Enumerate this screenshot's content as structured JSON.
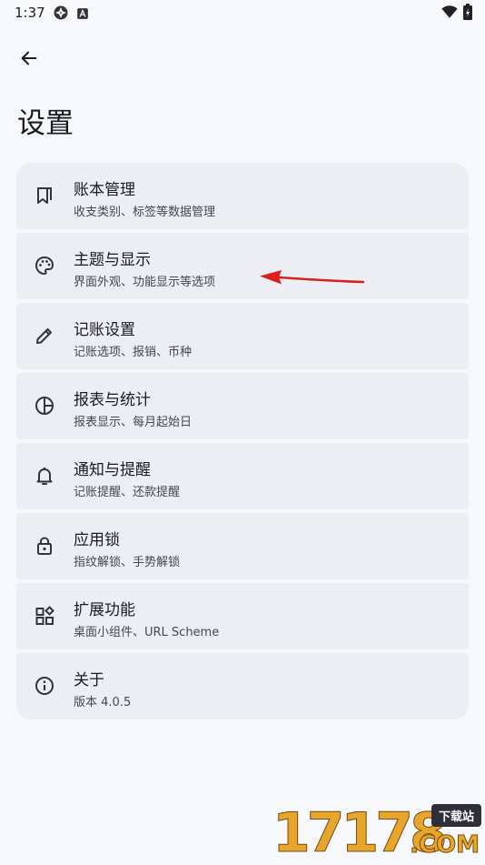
{
  "status_bar": {
    "time": "1:37"
  },
  "page": {
    "title": "设置"
  },
  "settings": [
    {
      "icon": "book-icon",
      "title": "账本管理",
      "subtitle": "收支类别、标签等数据管理"
    },
    {
      "icon": "palette-icon",
      "title": "主题与显示",
      "subtitle": "界面外观、功能显示等选项"
    },
    {
      "icon": "pencil-icon",
      "title": "记账设置",
      "subtitle": "记账选项、报销、币种"
    },
    {
      "icon": "pie-chart-icon",
      "title": "报表与统计",
      "subtitle": "报表显示、每月起始日"
    },
    {
      "icon": "bell-icon",
      "title": "通知与提醒",
      "subtitle": "记账提醒、还款提醒"
    },
    {
      "icon": "lock-icon",
      "title": "应用锁",
      "subtitle": "指纹解锁、手势解锁"
    },
    {
      "icon": "widgets-icon",
      "title": "扩展功能",
      "subtitle": "桌面小组件、URL Scheme"
    },
    {
      "icon": "info-icon",
      "title": "关于",
      "subtitle": "版本 4.0.5"
    }
  ],
  "watermark": {
    "digits": "17178",
    "badge": "下载站",
    "suffix": ".COM"
  },
  "colors": {
    "background": "#f7f8fc",
    "card": "#eceef4",
    "annotation_arrow": "#d9201c"
  }
}
